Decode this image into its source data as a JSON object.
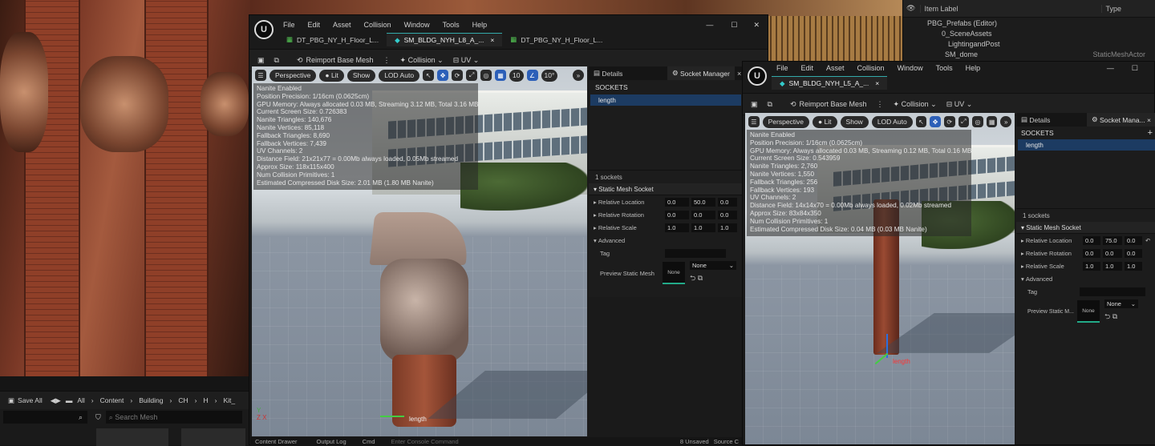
{
  "outliner": {
    "header_label": "Item Label",
    "header_type": "Type",
    "rows": [
      {
        "label": "PBG_Prefabs (Editor)",
        "type": ""
      },
      {
        "label": "0_SceneAssets",
        "type": ""
      },
      {
        "label": "LightingandPost",
        "type": ""
      },
      {
        "label": "SM_dome",
        "type": "StaticMeshActor"
      }
    ]
  },
  "menu": [
    "File",
    "Edit",
    "Asset",
    "Collision",
    "Window",
    "Tools",
    "Help"
  ],
  "win1": {
    "tabs": [
      "DT_PBG_NY_H_Floor_L...",
      "SM_BLDG_NYH_L8_A_...",
      "DT_PBG_NY_H_Floor_L..."
    ],
    "toolbar": {
      "reimport": "Reimport Base Mesh",
      "collision": "Collision",
      "uv": "UV"
    },
    "viewport": {
      "perspective": "Perspective",
      "lit": "Lit",
      "show": "Show",
      "lod": "LOD Auto",
      "grid_val": "10",
      "angle_val": "10°",
      "pivot_label": "length",
      "stats": [
        "Nanite Enabled",
        "Position Precision: 1/16cm (0.0625cm)",
        "GPU Memory: Always allocated 0.03 MB, Streaming 3.12 MB, Total 3.16 MB",
        "Current Screen Size: 0.726383",
        "Nanite Triangles: 140,676",
        "Nanite Vertices: 85,118",
        "Fallback Triangles: 8,690",
        "Fallback Vertices: 7,439",
        "UV Channels: 2",
        "Distance Field: 21x21x77 = 0.00Mb always loaded, 0.05Mb streamed",
        "Approx Size: 118x115x400",
        "Num Collision Primitives: 1",
        "Estimated Compressed Disk Size: 2.01 MB (1.80 MB Nanite)"
      ]
    },
    "details": {
      "tab_details": "Details",
      "tab_socket": "Socket Manager",
      "sockets_header": "SOCKETS",
      "socket_item": "length",
      "count": "1 sockets",
      "section": "Static Mesh Socket",
      "rows": [
        {
          "label": "Relative Location",
          "v": [
            "0.0",
            "50.0",
            "0.0"
          ]
        },
        {
          "label": "Relative Rotation",
          "v": [
            "0.0",
            "0.0",
            "0.0"
          ]
        },
        {
          "label": "Relative Scale",
          "v": [
            "1.0",
            "1.0",
            "1.0"
          ]
        }
      ],
      "advanced": "Advanced",
      "tag": "Tag",
      "preview": "Preview Static Mesh",
      "none_thumb": "None",
      "none_dd": "None"
    }
  },
  "win2": {
    "tab": "SM_BLDG_NYH_L5_A_...",
    "toolbar": {
      "reimport": "Reimport Base Mesh",
      "collision": "Collision",
      "uv": "UV"
    },
    "viewport": {
      "perspective": "Perspective",
      "lit": "Lit",
      "show": "Show",
      "lod": "LOD Auto",
      "pivot_label": "length",
      "stats": [
        "Nanite Enabled",
        "Position Precision: 1/16cm (0.0625cm)",
        "GPU Memory: Always allocated 0.03 MB, Streaming 0.12 MB, Total 0.16 MB",
        "Current Screen Size: 0.543959",
        "Nanite Triangles: 2,760",
        "Nanite Vertices: 1,550",
        "Fallback Triangles: 256",
        "Fallback Vertices: 193",
        "UV Channels: 2",
        "Distance Field: 14x14x70 = 0.00Mb always loaded, 0.02Mb streamed",
        "Approx Size: 83x84x350",
        "Num Collision Primitives: 1",
        "Estimated Compressed Disk Size: 0.04 MB (0.03 MB Nanite)"
      ]
    },
    "details": {
      "tab_details": "Details",
      "tab_socket": "Socket Mana...",
      "sockets_header": "SOCKETS",
      "socket_item": "length",
      "count": "1 sockets",
      "section": "Static Mesh Socket",
      "rows": [
        {
          "label": "Relative Location",
          "v": [
            "0.0",
            "75.0",
            "0.0"
          ]
        },
        {
          "label": "Relative Rotation",
          "v": [
            "0.0",
            "0.0",
            "0.0"
          ]
        },
        {
          "label": "Relative Scale",
          "v": [
            "1.0",
            "1.0",
            "1.0"
          ]
        }
      ],
      "advanced": "Advanced",
      "tag": "Tag",
      "preview": "Preview Static M...",
      "none_thumb": "None",
      "none_dd": "None"
    }
  },
  "content": {
    "save_all": "Save All",
    "path": [
      "All",
      "Content",
      "Building",
      "CH",
      "H",
      "Kit_"
    ],
    "search_placeholder": "Search Mesh"
  },
  "statusbar": {
    "drawer": "Content Drawer",
    "output": "Output Log",
    "cmd": "Cmd",
    "console": "Enter Console Command",
    "unsaved": "8 Unsaved",
    "source": "Source C"
  }
}
